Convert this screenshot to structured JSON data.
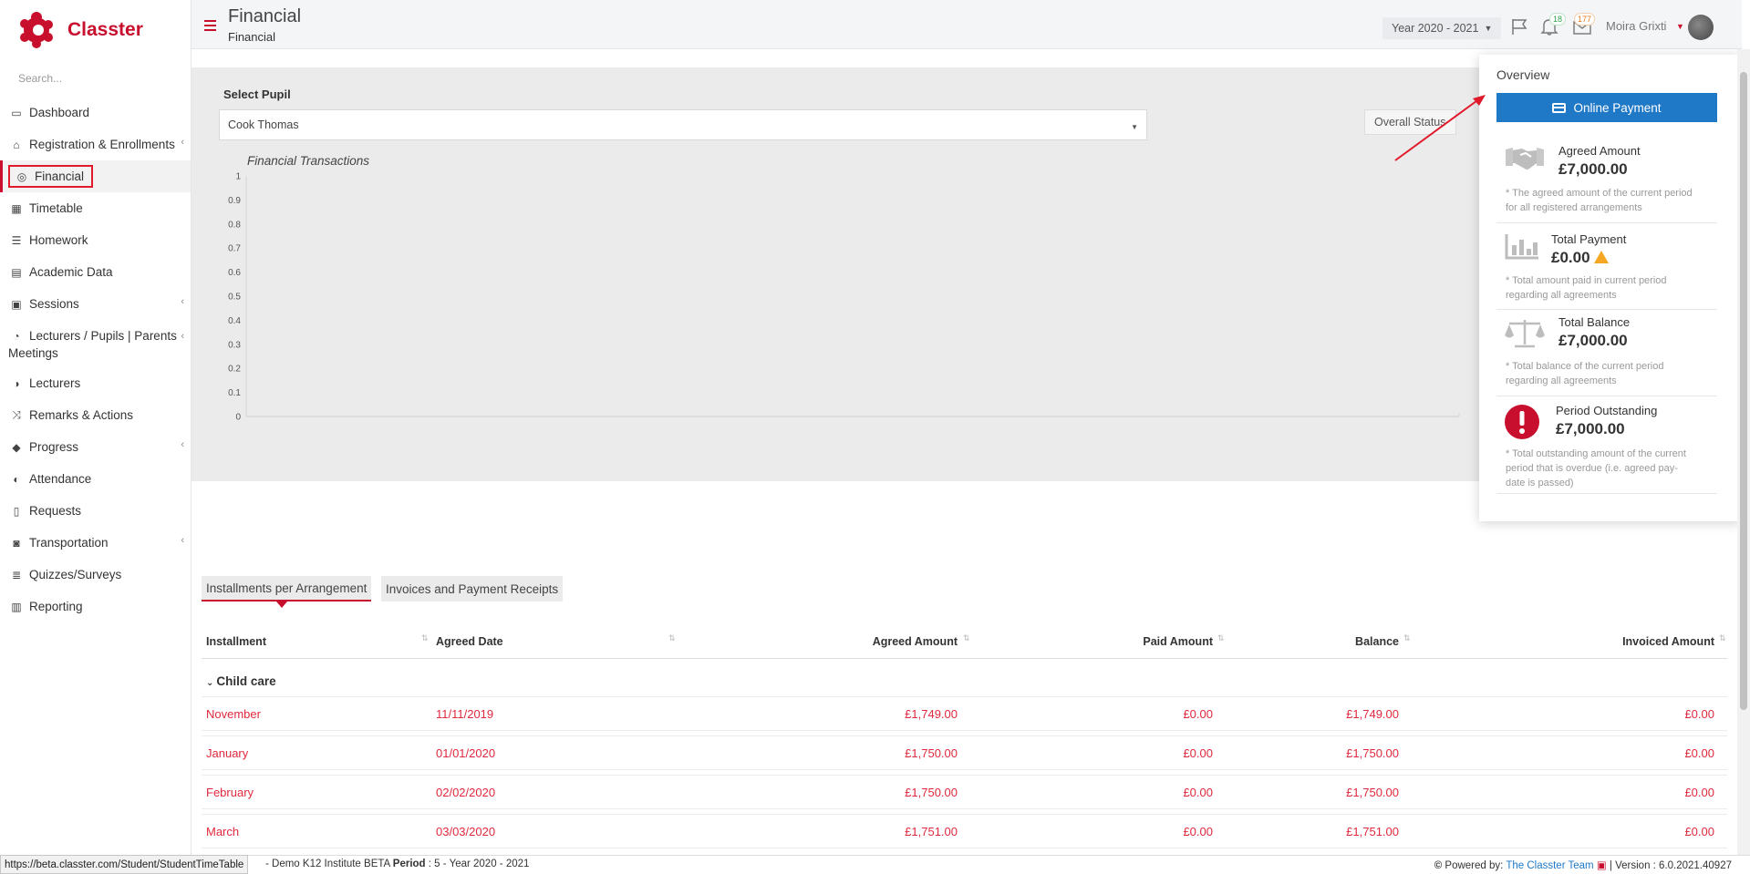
{
  "app": {
    "name": "Classter"
  },
  "sidebar": {
    "search_placeholder": "Search...",
    "items": [
      {
        "label": "Dashboard",
        "icon": "laptop-icon"
      },
      {
        "label": "Registration & Enrollments",
        "icon": "institution-icon",
        "has_submenu": true
      },
      {
        "label": "Financial",
        "icon": "coins-icon",
        "active": true
      },
      {
        "label": "Timetable",
        "icon": "calendar-icon"
      },
      {
        "label": "Homework",
        "icon": "tasks-icon"
      },
      {
        "label": "Academic Data",
        "icon": "chalkboard-icon"
      },
      {
        "label": "Sessions",
        "icon": "presentation-icon",
        "has_submenu": true
      },
      {
        "label": "Lecturers / Pupils | Parents Meetings",
        "icon": "user-clock-icon",
        "has_submenu": true
      },
      {
        "label": "Lecturers",
        "icon": "users-icon"
      },
      {
        "label": "Remarks & Actions",
        "icon": "shuffle-icon"
      },
      {
        "label": "Progress",
        "icon": "graduation-cap-icon",
        "has_submenu": true
      },
      {
        "label": "Attendance",
        "icon": "user-times-icon"
      },
      {
        "label": "Requests",
        "icon": "document-icon"
      },
      {
        "label": "Transportation",
        "icon": "bus-icon",
        "has_submenu": true
      },
      {
        "label": "Quizzes/Surveys",
        "icon": "checklist-icon"
      },
      {
        "label": "Reporting",
        "icon": "printer-icon"
      }
    ]
  },
  "header": {
    "title": "Financial",
    "subtitle": "Financial",
    "year": "Year 2020 - 2021",
    "notifications_count": "18",
    "messages_count": "177",
    "user_name": "Moira Grixti"
  },
  "filter": {
    "select_label": "Select Pupil",
    "selected_pupil": "Cook Thomas",
    "overall_status_label": "Overall Status"
  },
  "chart_data": {
    "type": "line",
    "title": "Financial Transactions",
    "series": [],
    "ylim": [
      0,
      1
    ],
    "yticks": [
      "0",
      "0.1",
      "0.2",
      "0.3",
      "0.4",
      "0.5",
      "0.6",
      "0.7",
      "0.8",
      "0.9",
      "1"
    ],
    "grid": false
  },
  "overview": {
    "title": "Overview",
    "online_payment_label": "Online Payment",
    "items": [
      {
        "label": "Agreed Amount",
        "amount": "£7,000.00",
        "note": "* The agreed amount of the current period for all registered arrangements",
        "icon": "handshake-icon"
      },
      {
        "label": "Total Payment",
        "amount": "£0.00",
        "note": "* Total amount paid in current period regarding all agreements",
        "icon": "bar-chart-icon",
        "warning": true
      },
      {
        "label": "Total Balance",
        "amount": "£7,000.00",
        "note": "* Total balance of the current period regarding all agreements",
        "icon": "balance-scale-icon"
      },
      {
        "label": "Period Outstanding",
        "amount": "£7,000.00",
        "note": "* Total outstanding amount of the current period that is overdue (i.e. agreed pay-date is passed)",
        "icon": "exclamation-icon"
      }
    ]
  },
  "tabs": [
    {
      "label": "Installments per Arrangement",
      "active": true
    },
    {
      "label": "Invoices and Payment Receipts",
      "active": false
    }
  ],
  "table": {
    "headers": [
      "Installment",
      "Agreed Date",
      "Agreed Amount",
      "Paid Amount",
      "Balance",
      "Invoiced Amount"
    ],
    "group": "Child care",
    "rows": [
      [
        "November",
        "11/11/2019",
        "£1,749.00",
        "£0.00",
        "£1,749.00",
        "£0.00"
      ],
      [
        "January",
        "01/01/2020",
        "£1,750.00",
        "£0.00",
        "£1,750.00",
        "£0.00"
      ],
      [
        "February",
        "02/02/2020",
        "£1,750.00",
        "£0.00",
        "£1,750.00",
        "£0.00"
      ],
      [
        "March",
        "03/03/2020",
        "£1,751.00",
        "£0.00",
        "£1,751.00",
        "£0.00"
      ]
    ]
  },
  "status_bar": {
    "url": "https://beta.classter.com/Student/StudentTimeTable",
    "institute": "- Demo K12 Institute BETA",
    "period_label": "Period",
    "period_value": ": 5 - Year 2020 - 2021",
    "powered_by": "Powered by:",
    "team": "The Classter Team",
    "version": "| Version : 6.0.2021.40927"
  },
  "colors": {
    "brand": "#c8102e",
    "accent": "#2079c7",
    "row_text": "#e0293d"
  }
}
